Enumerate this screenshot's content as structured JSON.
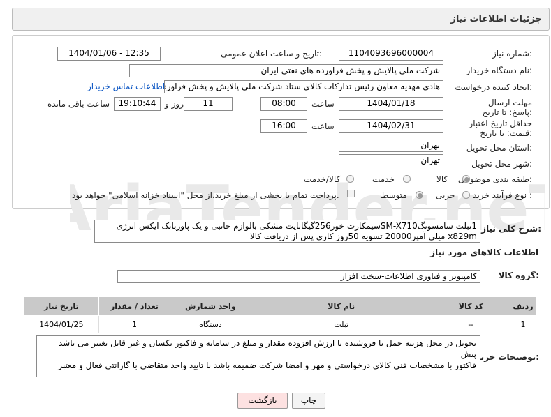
{
  "header": {
    "title": "جزئیات اطلاعات نیاز"
  },
  "form": {
    "need_number_label": "شماره نیاز:",
    "need_number": "1104093696000004",
    "announce_label": "تاریخ و ساعت اعلان عمومی:",
    "announce_value": "1404/01/06 - 12:35",
    "buyer_label": "نام دستگاه خریدار:",
    "buyer_value": "شرکت ملی پالایش و پخش فراورده های نفتی ایران",
    "creator_label": "ایجاد کننده درخواست:",
    "creator_value": "هادی مهدیه معاون رئیس تدارکات کالای ستاد شرکت ملی پالایش و پخش فراورد",
    "contact_link": "اطلاعات تماس خریدار",
    "deadline_label": "مهلت ارسال پاسخ: تا تاریخ:",
    "deadline_date": "1404/01/18",
    "time_label": "ساعت",
    "deadline_time": "08:00",
    "days_value": "11",
    "days_label": "روز و",
    "remaining_time": "19:10:44",
    "remaining_label": "ساعت باقی مانده",
    "validity_label": "حداقل تاریخ اعتبار قیمت: تا تاریخ:",
    "validity_date": "1404/02/31",
    "validity_time": "16:00",
    "province_label": "استان محل تحویل:",
    "province_value": "تهران",
    "city_label": "شهر محل تحویل:",
    "city_value": "تهران",
    "category_label": "طبقه بندی موضوعی:",
    "category_options": [
      "کالا",
      "خدمت",
      "کالا/خدمت"
    ],
    "purchase_label": "نوع فرآیند خرید :",
    "purchase_options": [
      "جزیی",
      "متوسط"
    ],
    "treasury_text": "پرداخت تمام یا بخشی از مبلغ خرید،از محل \"اسناد خزانه اسلامی\" خواهد بود."
  },
  "description": {
    "label": "شرح کلی نیاز:",
    "line1": "1تبلت سامسونگSM-X710سیمکارت خور256گیگابایت مشکی بالوازم جانبی و یک پاوربانک ایکس انرژی",
    "line2": "x829m میلی آمپر20000 تسویه 50روز کاری پس از دریافت کالا"
  },
  "goods_info_title": "اطلاعات کالاهای مورد نیاز",
  "goods_group": {
    "label": "گروه کالا:",
    "value": "کامپیوتر و فناوری اطلاعات-سخت افزار"
  },
  "table": {
    "headers": [
      "ردیف",
      "کد کالا",
      "نام کالا",
      "واحد شمارش",
      "تعداد / مقدار",
      "تاریخ نیاز"
    ],
    "rows": [
      [
        "1",
        "--",
        "تبلت",
        "دستگاه",
        "1",
        "1404/01/25"
      ]
    ]
  },
  "buyer_notes": {
    "label": "توضیحات خریدار:",
    "line1": "تحویل در محل هزینه حمل با فروشنده با ارزش افزوده مقدار و مبلغ در سامانه و فاکتور یکسان و غیر قابل تغییر می باشد پیش",
    "line2": "فاکتور با مشخصات فنی کالای درخواستی و مهر و امضا شرکت ضمیمه باشد با تایید واحد متقاضی با گارانتی فعال و معتبر"
  },
  "buttons": {
    "back": "بازگشت",
    "print": "چاپ"
  },
  "colors": {
    "header_bg": "#f0f0f0",
    "table_header_bg": "#c9c9c9",
    "link": "#0d57c4",
    "back_button_bg": "#fde1e1",
    "print_button_bg": "#f4f4f4"
  }
}
